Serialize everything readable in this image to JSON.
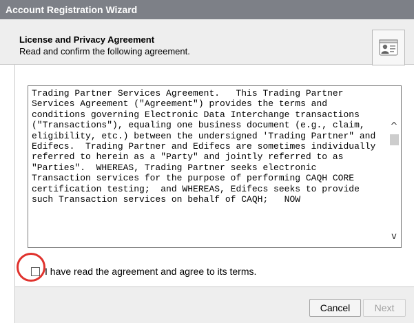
{
  "window": {
    "title": "Account Registration Wizard"
  },
  "header": {
    "title": "License and Privacy Agreement",
    "subtitle": "Read and confirm the following agreement.",
    "icon": "contact-card-icon"
  },
  "agreement": {
    "text": "Trading Partner Services Agreement.   This Trading Partner Services Agreement (\"Agreement\") provides the terms and conditions governing Electronic Data Interchange transactions (\"Transactions\"), equaling one business document (e.g., claim, eligibility, etc.) between the undersigned 'Trading Partner\" and Edifecs.  Trading Partner and Edifecs are sometimes individually referred to herein as a \"Party\" and jointly referred to as \"Parties\".  WHEREAS, Trading Partner seeks electronic Transaction services for the purpose of performing CAQH CORE certification testing;  and WHEREAS, Edifecs seeks to provide such Transaction services on behalf of CAQH;   NOW",
    "scroll_up_glyph": "^",
    "scroll_down_glyph": "v"
  },
  "agree": {
    "label": "I have read the agreement and agree to its terms.",
    "checked": false
  },
  "footer": {
    "cancel_label": "Cancel",
    "next_label": "Next",
    "next_enabled": false
  },
  "colors": {
    "titlebar": "#7d8087",
    "panel": "#eeeeee",
    "highlight": "#e0322d",
    "disabled_text": "#a0a0a0"
  }
}
